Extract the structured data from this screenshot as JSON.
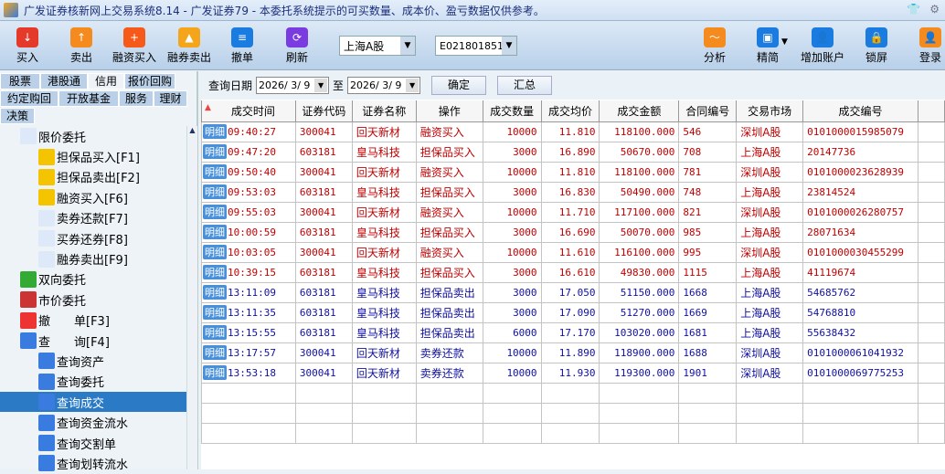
{
  "title": "广发证券核新网上交易系统8.14 - 广发证券79 - 本委托系统提示的可买数量、成本价、盈亏数据仅供参考。",
  "toolbar": {
    "buy": "买入",
    "sell": "卖出",
    "margin_buy": "融资买入",
    "short_sell": "融券卖出",
    "cancel": "撤单",
    "refresh": "刷新",
    "market": "上海A股",
    "account": "E021801851",
    "analysis": "分析",
    "simple": "精简",
    "add_account": "增加账户",
    "lock": "锁屏",
    "login": "登录"
  },
  "tabs": [
    "股票",
    "港股通",
    "信用",
    "报价回购",
    "约定购回",
    "开放基金",
    "服务",
    "理财",
    "决策"
  ],
  "tree": [
    "限价委托",
    "担保品买入[F1]",
    "担保品卖出[F2]",
    "融资买入[F6]",
    "卖券还款[F7]",
    "买券还券[F8]",
    "融券卖出[F9]",
    "双向委托",
    "市价委托",
    "撤　　单[F3]",
    "查　　询[F4]",
    "查询资产",
    "查询委托",
    "查询成交",
    "查询资金流水",
    "查询交割单",
    "查询划转流水"
  ],
  "query": {
    "label": "查询日期",
    "from": "2026/ 3/ 9",
    "to_label": "至",
    "to": "2026/ 3/ 9",
    "confirm": "确定",
    "summary": "汇总"
  },
  "detail_label": "明细",
  "columns": [
    "成交时间",
    "证券代码",
    "证券名称",
    "操作",
    "成交数量",
    "成交均价",
    "成交金额",
    "合同编号",
    "交易市场",
    "成交编号"
  ],
  "rows": [
    [
      "09:40:27",
      "300041",
      "回天新材",
      "融资买入",
      "10000",
      "11.810",
      "118100.000",
      "546",
      "深圳A股",
      "0101000015985079"
    ],
    [
      "09:47:20",
      "603181",
      "皇马科技",
      "担保品买入",
      "3000",
      "16.890",
      "50670.000",
      "708",
      "上海A股",
      "20147736"
    ],
    [
      "09:50:40",
      "300041",
      "回天新材",
      "融资买入",
      "10000",
      "11.810",
      "118100.000",
      "781",
      "深圳A股",
      "0101000023628939"
    ],
    [
      "09:53:03",
      "603181",
      "皇马科技",
      "担保品买入",
      "3000",
      "16.830",
      "50490.000",
      "748",
      "上海A股",
      "23814524"
    ],
    [
      "09:55:03",
      "300041",
      "回天新材",
      "融资买入",
      "10000",
      "11.710",
      "117100.000",
      "821",
      "深圳A股",
      "0101000026280757"
    ],
    [
      "10:00:59",
      "603181",
      "皇马科技",
      "担保品买入",
      "3000",
      "16.690",
      "50070.000",
      "985",
      "上海A股",
      "28071634"
    ],
    [
      "10:03:05",
      "300041",
      "回天新材",
      "融资买入",
      "10000",
      "11.610",
      "116100.000",
      "995",
      "深圳A股",
      "0101000030455299"
    ],
    [
      "10:39:15",
      "603181",
      "皇马科技",
      "担保品买入",
      "3000",
      "16.610",
      "49830.000",
      "1115",
      "上海A股",
      "41119674"
    ],
    [
      "13:11:09",
      "603181",
      "皇马科技",
      "担保品卖出",
      "3000",
      "17.050",
      "51150.000",
      "1668",
      "上海A股",
      "54685762"
    ],
    [
      "13:11:35",
      "603181",
      "皇马科技",
      "担保品卖出",
      "3000",
      "17.090",
      "51270.000",
      "1669",
      "上海A股",
      "54768810"
    ],
    [
      "13:15:55",
      "603181",
      "皇马科技",
      "担保品卖出",
      "6000",
      "17.170",
      "103020.000",
      "1681",
      "上海A股",
      "55638432"
    ],
    [
      "13:17:57",
      "300041",
      "回天新材",
      "卖券还款",
      "10000",
      "11.890",
      "118900.000",
      "1688",
      "深圳A股",
      "0101000061041932"
    ],
    [
      "13:53:18",
      "300041",
      "回天新材",
      "卖券还款",
      "10000",
      "11.930",
      "119300.000",
      "1901",
      "深圳A股",
      "0101000069775253"
    ]
  ],
  "colors": {
    "buy": "#c00000",
    "sell": "#1010a0",
    "selected": "#2b7ac6"
  }
}
